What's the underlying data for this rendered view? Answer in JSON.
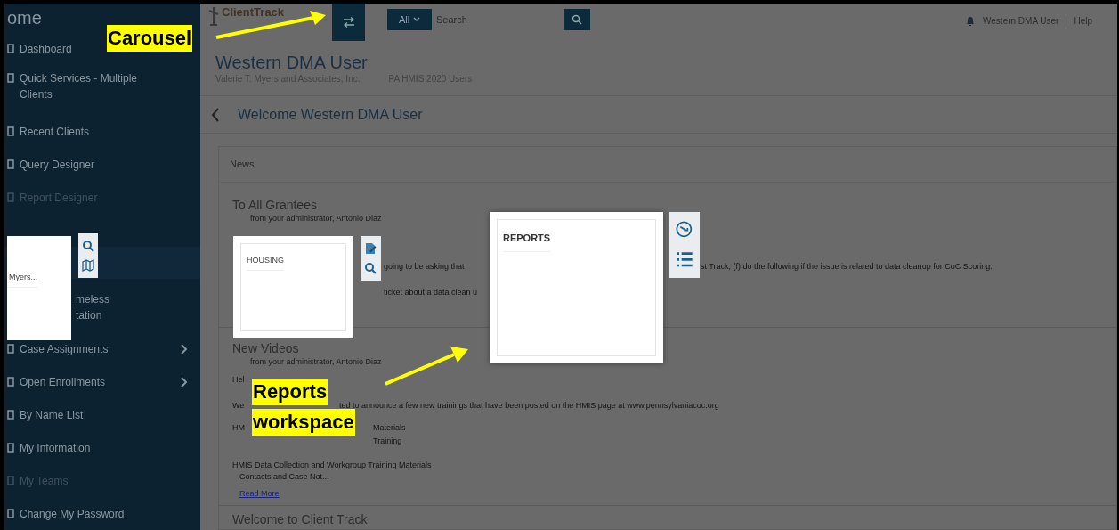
{
  "sidebar": {
    "title": "ome",
    "items": [
      {
        "lines": [
          "Dashboard"
        ],
        "disabled": false,
        "submenu": false
      },
      {
        "lines": [
          "Quick Services - Multiple",
          "Clients"
        ],
        "disabled": false,
        "submenu": false
      },
      {
        "lines": [
          "Recent Clients"
        ],
        "disabled": false,
        "submenu": false
      },
      {
        "lines": [
          "Query Designer"
        ],
        "disabled": false,
        "submenu": false
      },
      {
        "lines": [
          "Report Designer"
        ],
        "disabled": true,
        "submenu": false
      },
      {
        "lines": [
          "meless",
          "tation"
        ],
        "disabled": false,
        "submenu": false
      },
      {
        "lines": [
          "Case Assignments"
        ],
        "disabled": false,
        "submenu": true
      },
      {
        "lines": [
          "Open Enrollments"
        ],
        "disabled": false,
        "submenu": true
      },
      {
        "lines": [
          "By Name List"
        ],
        "disabled": false,
        "submenu": false
      },
      {
        "lines": [
          "My Information"
        ],
        "disabled": false,
        "submenu": false
      },
      {
        "lines": [
          "My Teams"
        ],
        "disabled": true,
        "submenu": false
      },
      {
        "lines": [
          "Change My Password"
        ],
        "disabled": false,
        "submenu": false
      }
    ]
  },
  "topbar": {
    "logo": "ClientTrack",
    "scope": "All",
    "search_placeholder": "Search",
    "user": "Western DMA User",
    "links": [
      "Help"
    ]
  },
  "header": {
    "title": "Western DMA User",
    "org": "Valerie T. Myers and Associates, Inc.",
    "group": "PA HMIS 2020 Users"
  },
  "breadcrumb": "Welcome Western DMA User",
  "news": {
    "title": "News",
    "posts": [
      {
        "title": "To All Grantees",
        "from": "from your administrator, Antonio Diaz",
        "lines": [
          [
            "going to be asking that",
            "st Track, (f) do the following if the issue is related to data cleanup for CoC Scoring."
          ],
          [
            "ticket about a data clean u"
          ]
        ]
      },
      {
        "title": "New Videos",
        "from": "from your administrator, Antonio Diaz",
        "lines": [
          [
            "Hel"
          ],
          [
            "We",
            "ted to announce a few new trainings that have been posted on the HMIS page at www.pennsylvaniacoc.org"
          ],
          [
            "HM",
            "Materials"
          ],
          [
            "Training"
          ],
          [
            "HMIS Data Collection and Workgroup Training Materials"
          ],
          [
            "Contacts and Case Not..."
          ]
        ],
        "link": "Read More"
      }
    ],
    "footer_title": "Welcome to Client Track"
  },
  "carousel": {
    "cards": [
      {
        "title": "Myers...",
        "selected": false
      },
      {
        "title": "HOUSING",
        "selected": false
      },
      {
        "title": "REPORTS",
        "selected": true
      }
    ]
  },
  "callouts": [
    {
      "lines": [
        "Carousel"
      ]
    },
    {
      "lines": [
        "Reports",
        "workspace"
      ]
    }
  ]
}
